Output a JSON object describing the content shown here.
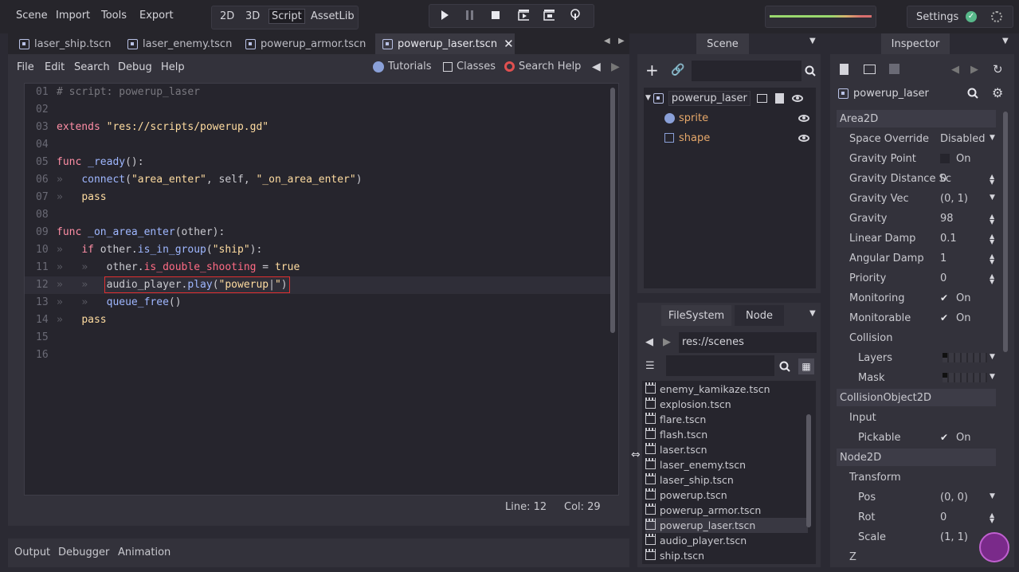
{
  "topbar": {
    "menus": [
      "Scene",
      "Import",
      "Tools",
      "Export"
    ],
    "modes": [
      "2D",
      "3D",
      "Script",
      "AssetLib"
    ],
    "active_mode": "Script",
    "settings_label": "Settings",
    "progress_colors": [
      "#a8e07a",
      "#e0b07a",
      "#e07a7a"
    ]
  },
  "tabs": [
    {
      "label": "laser_ship.tscn"
    },
    {
      "label": "laser_enemy.tscn"
    },
    {
      "label": "powerup_armor.tscn"
    },
    {
      "label": "powerup_laser.tscn",
      "active": true
    }
  ],
  "editor": {
    "menus": [
      "File",
      "Edit",
      "Search",
      "Debug",
      "Help"
    ],
    "tools": {
      "tutorials": "Tutorials",
      "classes": "Classes",
      "search_help": "Search Help"
    },
    "status": {
      "line": "Line: 12",
      "col": "Col: 29"
    }
  },
  "code_lines": [
    {
      "num": "01",
      "html": "<span class='c'># script: powerup_laser</span>"
    },
    {
      "num": "02",
      "html": ""
    },
    {
      "num": "03",
      "html": "<span class='k'>extends</span> <span class='s'>\"res://scripts/powerup.gd\"</span>"
    },
    {
      "num": "04",
      "html": ""
    },
    {
      "num": "05",
      "html": "<span class='k'>func</span> <span class='f'>_ready</span>():"
    },
    {
      "num": "06",
      "html": "<span class='tabm'>»</span>   <span class='f'>connect</span>(<span class='s'>\"area_enter\"</span>, self, <span class='s'>\"_on_area_enter\"</span>)"
    },
    {
      "num": "07",
      "html": "<span class='tabm'>»</span>   <span class='s'>pass</span>"
    },
    {
      "num": "08",
      "html": ""
    },
    {
      "num": "09",
      "html": "<span class='k'>func</span> <span class='f'>_on_area_enter</span>(other):"
    },
    {
      "num": "10",
      "html": "<span class='tabm'>»</span>   <span class='k'>if</span> other.<span class='f'>is_in_group</span>(<span class='s'>\"ship\"</span>):"
    },
    {
      "num": "11",
      "html": "<span class='tabm'>»</span>   <span class='tabm'>»</span>   other.<span class='p'>is_double_shooting</span> = <span class='s'>true</span>"
    },
    {
      "num": "12",
      "html": "<span class='tabm'>»</span>   <span class='tabm'>»</span>   <span style='outline:1.5px solid #e03030;outline-offset:2px'>audio_player.<span class='f'>play</span>(<span class='s'>\"powerup</span>|<span class='s'>\"</span>)</span>",
      "current": true
    },
    {
      "num": "13",
      "html": "<span class='tabm'>»</span>   <span class='tabm'>»</span>   <span class='f'>queue_free</span>()"
    },
    {
      "num": "14",
      "html": "<span class='tabm'>»</span>   <span class='s'>pass</span>"
    },
    {
      "num": "15",
      "html": ""
    },
    {
      "num": "16",
      "html": ""
    }
  ],
  "bottom_tabs": [
    "Output",
    "Debugger",
    "Animation"
  ],
  "scene_dock": {
    "title": "Scene",
    "root": "powerup_laser",
    "children": [
      "sprite",
      "shape"
    ]
  },
  "fs_dock": {
    "tabs": [
      "FileSystem",
      "Node"
    ],
    "path": "res://scenes",
    "files": [
      "enemy_kamikaze.tscn",
      "explosion.tscn",
      "flare.tscn",
      "flash.tscn",
      "laser.tscn",
      "laser_enemy.tscn",
      "laser_ship.tscn",
      "powerup.tscn",
      "powerup_armor.tscn",
      "powerup_laser.tscn",
      "audio_player.tscn",
      "ship.tscn"
    ],
    "selected": "powerup_laser.tscn"
  },
  "inspector": {
    "title": "Inspector",
    "node": "powerup_laser",
    "sections": {
      "area2d": "Area2D",
      "collisionobject2d": "CollisionObject2D",
      "node2d": "Node2D"
    },
    "props": {
      "space_override": {
        "label": "Space Override",
        "value": "Disabled"
      },
      "gravity_point": {
        "label": "Gravity Point",
        "value": "On"
      },
      "gravity_distance": {
        "label": "Gravity Distance Sc",
        "value": "0"
      },
      "gravity_vec": {
        "label": "Gravity Vec",
        "value": "(0, 1)"
      },
      "gravity": {
        "label": "Gravity",
        "value": "98"
      },
      "linear_damp": {
        "label": "Linear Damp",
        "value": "0.1"
      },
      "angular_damp": {
        "label": "Angular Damp",
        "value": "1"
      },
      "priority": {
        "label": "Priority",
        "value": "0"
      },
      "monitoring": {
        "label": "Monitoring",
        "value": "On"
      },
      "monitorable": {
        "label": "Monitorable",
        "value": "On"
      },
      "collision": {
        "label": "Collision"
      },
      "layers": {
        "label": "Layers"
      },
      "mask": {
        "label": "Mask"
      },
      "input": {
        "label": "Input"
      },
      "pickable": {
        "label": "Pickable",
        "value": "On"
      },
      "transform": {
        "label": "Transform"
      },
      "pos": {
        "label": "Pos",
        "value": "(0, 0)"
      },
      "rot": {
        "label": "Rot",
        "value": "0"
      },
      "scale": {
        "label": "Scale",
        "value": "(1, 1)"
      },
      "z": {
        "label": "Z"
      }
    }
  }
}
